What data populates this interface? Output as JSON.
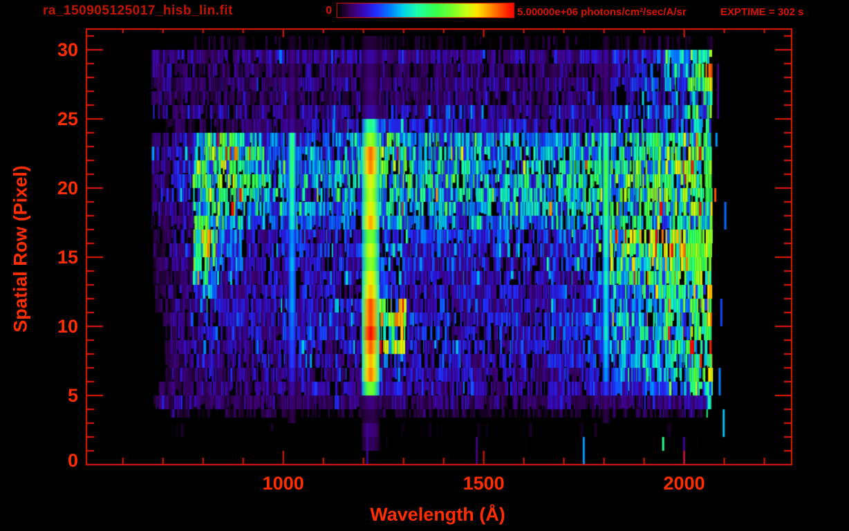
{
  "window": {
    "background": "#000000",
    "accent_colors": {
      "frame_red": "#e81800",
      "tick_label_red": "#ff2d00",
      "annotation_red": "#d81400",
      "title_red": "#c41400"
    }
  },
  "chart_data": {
    "type": "heatmap",
    "title": "ra_150905125017_hisb_lin.fit",
    "xlabel": "Wavelength (Å)",
    "ylabel": "Spatial Row (Pixel)",
    "exptime_label": "EXPTIME = 302 s",
    "colorbar": {
      "min": 0,
      "max": 5000000,
      "min_label": "0",
      "max_text": "5.00000e+06 photons/cm²/sec/A/sr",
      "colormap": "rainbow-black-to-red",
      "position": "top"
    },
    "x_range": [
      509,
      2268
    ],
    "y_range": [
      0,
      31.5
    ],
    "x_ticks_major": [
      1000,
      1500,
      2000
    ],
    "x_minor_step": 100,
    "x_minor_from": 600,
    "x_minor_to": 2200,
    "y_ticks_major": [
      0,
      5,
      10,
      15,
      20,
      25,
      30
    ],
    "y_minor_step": 1,
    "grid": false,
    "value_units": "1e6 photons/cm2/sec/A/sr",
    "data_extent_wavelength": [
      668,
      2070
    ],
    "spatial_row_range": [
      0,
      30
    ],
    "wavelength_edges": [
      668,
      719,
      777,
      836,
      895,
      954,
      1012,
      1032,
      1071,
      1130,
      1196,
      1240,
      1306,
      1365,
      1424,
      1482,
      1541,
      1600,
      1659,
      1717,
      1796,
      1814,
      1894,
      1952,
      2011,
      2055,
      2070
    ],
    "row_order_note": "values[0] is spatial row 0 (bottom), values[30] is row 30 (top); 26 columns per row matching wavelength_edges bins; units 1e6 photons/cm2/sec/A/sr",
    "values": [
      [
        0,
        0,
        0,
        0,
        0,
        0,
        0,
        0,
        0,
        0,
        0.1,
        0,
        0,
        0,
        0,
        0,
        0,
        0,
        0,
        0,
        0,
        0,
        0,
        0,
        0,
        0.1
      ],
      [
        0,
        0,
        0,
        0,
        0,
        0.05,
        0,
        0,
        0.05,
        0,
        0.4,
        0.05,
        0,
        0,
        0.05,
        0,
        0,
        0.05,
        0,
        0,
        0.05,
        0,
        0,
        0.05,
        0.1,
        0.3
      ],
      [
        0,
        0.1,
        0,
        0.1,
        0,
        0.1,
        0,
        0.1,
        0,
        0.1,
        0.5,
        0.1,
        0,
        0.1,
        0,
        0.1,
        0,
        0.1,
        0,
        0.1,
        0,
        0.1,
        0,
        0.1,
        0.2,
        1.4
      ],
      [
        0.2,
        0.25,
        0.2,
        0.25,
        0.2,
        0.3,
        0.25,
        0.2,
        0.25,
        0.2,
        0.3,
        0.25,
        0.2,
        0.25,
        0.3,
        0.25,
        0.2,
        0.25,
        0.3,
        0.25,
        0.3,
        0.25,
        0.3,
        0.25,
        0.35,
        1.5
      ],
      [
        0.35,
        0.4,
        0.35,
        0.4,
        0.35,
        0.4,
        0.45,
        0.4,
        0.35,
        0.4,
        0.45,
        0.4,
        0.35,
        0.4,
        0.45,
        0.4,
        0.35,
        0.4,
        0.45,
        0.4,
        0.45,
        0.4,
        0.45,
        0.4,
        0.5,
        1.6
      ],
      [
        0.3,
        0.35,
        0.4,
        0.4,
        0.45,
        0.5,
        0.6,
        0.55,
        0.5,
        0.55,
        3.2,
        0.7,
        0.55,
        0.6,
        0.55,
        0.5,
        0.55,
        0.5,
        0.6,
        0.65,
        1.2,
        0.9,
        1.1,
        1.3,
        1.6,
        2.2
      ],
      [
        0.2,
        0.35,
        0.5,
        0.45,
        0.5,
        0.55,
        0.9,
        0.6,
        0.55,
        0.6,
        4.0,
        0.9,
        0.6,
        0.65,
        0.6,
        0.55,
        0.6,
        0.55,
        0.65,
        0.7,
        1.7,
        1.1,
        1.3,
        1.5,
        1.9,
        4.0
      ],
      [
        0.2,
        0.4,
        0.55,
        0.5,
        0.55,
        0.65,
        1.2,
        0.7,
        0.6,
        0.65,
        4.3,
        1.0,
        0.65,
        0.7,
        0.65,
        0.6,
        0.65,
        0.6,
        0.7,
        0.8,
        1.8,
        1.2,
        1.4,
        1.6,
        2.0,
        2.5
      ],
      [
        0.25,
        0.45,
        0.6,
        0.55,
        0.6,
        0.7,
        1.3,
        0.8,
        0.7,
        0.75,
        4.4,
        2.5,
        0.75,
        0.8,
        0.75,
        0.7,
        0.75,
        0.7,
        0.8,
        0.9,
        1.9,
        1.3,
        1.5,
        1.8,
        2.2,
        4.2
      ],
      [
        0.3,
        0.5,
        0.65,
        0.6,
        0.65,
        0.75,
        1.4,
        0.85,
        0.75,
        0.8,
        4.7,
        2.6,
        0.8,
        0.85,
        0.8,
        0.75,
        0.8,
        0.75,
        0.85,
        0.95,
        2.0,
        1.4,
        1.6,
        1.9,
        2.3,
        2.8
      ],
      [
        0.3,
        0.5,
        0.7,
        0.6,
        0.65,
        0.75,
        1.4,
        0.85,
        0.75,
        0.8,
        4.2,
        2.7,
        0.8,
        0.85,
        0.8,
        0.75,
        0.8,
        0.75,
        0.85,
        0.95,
        2.0,
        1.4,
        1.6,
        1.9,
        2.3,
        4.4
      ],
      [
        0.3,
        0.45,
        0.9,
        0.65,
        0.6,
        0.7,
        1.5,
        0.8,
        0.7,
        0.75,
        4.6,
        2.6,
        0.75,
        0.8,
        0.75,
        0.7,
        0.75,
        0.7,
        0.8,
        0.9,
        1.9,
        1.3,
        1.5,
        1.8,
        2.2,
        2.6
      ],
      [
        0.25,
        0.4,
        1.2,
        0.7,
        0.6,
        0.65,
        1.5,
        0.75,
        0.65,
        0.7,
        4.3,
        1.1,
        0.7,
        0.75,
        0.7,
        0.65,
        0.7,
        0.65,
        0.75,
        0.85,
        1.9,
        1.4,
        1.6,
        1.8,
        2.2,
        4.2
      ],
      [
        0.25,
        0.4,
        1.8,
        0.8,
        0.6,
        0.65,
        1.5,
        0.75,
        0.65,
        0.7,
        4.0,
        1.0,
        0.7,
        0.75,
        0.7,
        0.65,
        0.7,
        0.65,
        0.8,
        0.9,
        2.0,
        1.9,
        2.0,
        2.1,
        2.3,
        2.6
      ],
      [
        0.3,
        0.45,
        2.2,
        1.0,
        0.65,
        0.7,
        1.6,
        0.8,
        0.7,
        0.75,
        3.6,
        1.1,
        0.8,
        0.85,
        0.8,
        0.75,
        0.8,
        0.75,
        0.9,
        1.1,
        2.1,
        2.4,
        2.5,
        2.6,
        2.9,
        3.4
      ],
      [
        0.3,
        0.5,
        2.6,
        1.1,
        0.7,
        0.75,
        1.6,
        0.85,
        0.75,
        0.8,
        3.4,
        1.2,
        0.85,
        0.9,
        0.85,
        0.8,
        0.85,
        0.8,
        0.95,
        1.2,
        2.2,
        2.5,
        2.6,
        2.7,
        3.0,
        3.5
      ],
      [
        0.3,
        0.5,
        2.5,
        1.2,
        0.8,
        0.8,
        1.6,
        0.9,
        0.8,
        0.9,
        3.2,
        1.3,
        0.9,
        1.0,
        0.9,
        0.85,
        0.9,
        0.85,
        1.0,
        1.2,
        2.2,
        2.4,
        2.5,
        2.6,
        2.9,
        3.3
      ],
      [
        0.4,
        0.6,
        2.3,
        1.6,
        1.2,
        1.0,
        1.9,
        1.1,
        1.0,
        1.1,
        4.0,
        1.6,
        1.2,
        1.3,
        1.2,
        1.1,
        1.2,
        1.1,
        1.3,
        1.4,
        2.3,
        1.8,
        1.9,
        2.0,
        2.1,
        2.5
      ],
      [
        0.4,
        0.6,
        1.8,
        2.0,
        1.5,
        1.2,
        2.1,
        1.3,
        1.2,
        1.3,
        3.8,
        1.8,
        1.5,
        1.6,
        1.5,
        1.4,
        1.5,
        1.4,
        1.6,
        1.7,
        2.5,
        2.0,
        2.1,
        2.2,
        2.3,
        2.7
      ],
      [
        0.4,
        0.7,
        1.9,
        2.2,
        1.7,
        1.3,
        2.2,
        1.4,
        1.3,
        1.4,
        3.4,
        1.9,
        1.6,
        1.7,
        1.6,
        1.5,
        1.6,
        1.5,
        1.7,
        1.8,
        2.6,
        2.1,
        2.2,
        2.3,
        2.4,
        2.8
      ],
      [
        0.5,
        0.8,
        2.0,
        2.4,
        1.8,
        1.4,
        2.3,
        1.5,
        1.4,
        1.5,
        3.6,
        2.0,
        1.7,
        1.8,
        1.7,
        1.6,
        1.7,
        1.6,
        1.8,
        1.9,
        2.7,
        2.2,
        2.3,
        2.4,
        2.5,
        3.0
      ],
      [
        0.5,
        0.7,
        2.2,
        2.5,
        1.9,
        1.3,
        2.4,
        1.4,
        1.3,
        1.4,
        4.2,
        2.2,
        1.6,
        1.7,
        1.6,
        1.5,
        1.6,
        1.5,
        1.7,
        1.8,
        2.6,
        2.1,
        2.2,
        2.3,
        2.4,
        2.9
      ],
      [
        0.6,
        0.8,
        2.4,
        2.6,
        1.8,
        1.2,
        2.4,
        1.3,
        1.2,
        1.3,
        4.0,
        2.2,
        1.5,
        1.6,
        1.5,
        1.4,
        1.5,
        1.4,
        1.5,
        1.6,
        2.5,
        2.0,
        2.1,
        2.2,
        2.3,
        2.8
      ],
      [
        0.5,
        0.7,
        1.6,
        2.2,
        1.4,
        1.0,
        2.2,
        1.1,
        1.0,
        1.1,
        3.5,
        1.8,
        1.3,
        1.4,
        1.3,
        1.2,
        1.3,
        1.2,
        1.3,
        1.4,
        2.4,
        1.8,
        1.9,
        2.0,
        2.2,
        2.6
      ],
      [
        0.2,
        0.3,
        0.35,
        0.4,
        0.45,
        0.5,
        0.6,
        0.55,
        0.6,
        0.7,
        2.2,
        0.9,
        0.7,
        0.75,
        0.7,
        0.65,
        0.7,
        0.6,
        0.65,
        0.7,
        0.8,
        0.8,
        0.9,
        1.0,
        1.3,
        1.8
      ],
      [
        0.5,
        0.45,
        0.5,
        0.55,
        0.5,
        0.45,
        0.5,
        0.55,
        0.6,
        0.55,
        0.7,
        0.6,
        0.55,
        0.6,
        0.65,
        0.6,
        0.55,
        0.5,
        0.55,
        0.6,
        0.65,
        0.7,
        0.9,
        1.1,
        1.6,
        2.0
      ],
      [
        0.35,
        0.4,
        0.35,
        0.4,
        0.35,
        0.4,
        0.45,
        0.4,
        0.35,
        0.4,
        0.45,
        0.4,
        0.35,
        0.4,
        0.45,
        0.4,
        0.35,
        0.4,
        0.45,
        0.4,
        0.45,
        0.6,
        0.8,
        1.0,
        1.4,
        1.8
      ],
      [
        0.45,
        0.4,
        0.45,
        0.4,
        0.45,
        0.4,
        0.45,
        0.5,
        0.45,
        0.4,
        0.5,
        0.45,
        0.4,
        0.45,
        0.5,
        0.45,
        0.4,
        0.45,
        0.5,
        0.45,
        0.5,
        0.7,
        1.1,
        1.6,
        2.2,
        4.0
      ],
      [
        0.4,
        0.35,
        0.4,
        0.35,
        0.4,
        0.35,
        0.4,
        0.35,
        0.4,
        0.35,
        0.45,
        0.4,
        0.35,
        0.4,
        0.35,
        0.4,
        0.35,
        0.4,
        0.35,
        0.4,
        0.45,
        0.6,
        0.9,
        1.5,
        2.2,
        4.3
      ],
      [
        0.5,
        0.55,
        0.5,
        0.45,
        0.5,
        0.55,
        0.5,
        0.45,
        0.5,
        0.55,
        0.6,
        0.5,
        0.55,
        0.5,
        0.45,
        0.55,
        0.5,
        0.45,
        0.5,
        0.55,
        0.6,
        0.7,
        0.9,
        1.4,
        2.0,
        2.4
      ],
      [
        0,
        0,
        0.15,
        0.2,
        0.15,
        0.2,
        0.15,
        0.2,
        0.15,
        0.2,
        0.25,
        0.15,
        0.2,
        0.15,
        0.2,
        0.15,
        0.2,
        0.15,
        0.2,
        0.15,
        0.2,
        0.15,
        0.2,
        0.15,
        0.2,
        0.25
      ]
    ],
    "row_fill_density": [
      0.04,
      0.05,
      0.12,
      0.5,
      0.95,
      0.9,
      0.9,
      0.9,
      0.9,
      0.9,
      0.9,
      0.92,
      0.92,
      0.92,
      0.92,
      0.92,
      0.92,
      0.93,
      0.93,
      0.93,
      0.93,
      0.93,
      0.93,
      0.93,
      0.85,
      0.88,
      0.85,
      0.88,
      0.85,
      0.95,
      0.35
    ],
    "row_start_lambda": [
      672,
      672,
      672,
      700,
      676,
      690,
      706,
      706,
      706,
      706,
      700,
      680,
      680,
      676,
      676,
      676,
      676,
      672,
      672,
      672,
      672,
      672,
      672,
      672,
      707,
      672,
      672,
      672,
      672,
      671,
      745
    ],
    "smooth_line_columns": [
      6,
      10,
      20
    ],
    "stray_marks": [
      {
        "lambda": 1207,
        "row_lo": 0,
        "row_hi": 2,
        "value": 0.6
      },
      {
        "lambda": 1480,
        "row_lo": 0,
        "row_hi": 1,
        "value": 0.5
      },
      {
        "lambda": 1747,
        "row_lo": 0,
        "row_hi": 1,
        "value": 1.6
      },
      {
        "lambda": 1945,
        "row_lo": 1,
        "row_hi": 1,
        "value": 2.4
      },
      {
        "lambda": 1997,
        "row_lo": 0,
        "row_hi": 1,
        "value": 0.6
      },
      {
        "lambda": 2075,
        "row_lo": 19,
        "row_hi": 19,
        "value": 4.6
      },
      {
        "lambda": 2078,
        "row_lo": 23,
        "row_hi": 23,
        "value": 1.6
      },
      {
        "lambda": 2082,
        "row_lo": 25,
        "row_hi": 28,
        "value": 0.5
      },
      {
        "lambda": 2090,
        "row_lo": 10,
        "row_hi": 11,
        "value": 1.2
      },
      {
        "lambda": 2086,
        "row_lo": 5,
        "row_hi": 6,
        "value": 1.5
      },
      {
        "lambda": 2096,
        "row_lo": 2,
        "row_hi": 3,
        "value": 1.8
      },
      {
        "lambda": 2100,
        "row_lo": 17,
        "row_hi": 18,
        "value": 1.4
      }
    ]
  }
}
